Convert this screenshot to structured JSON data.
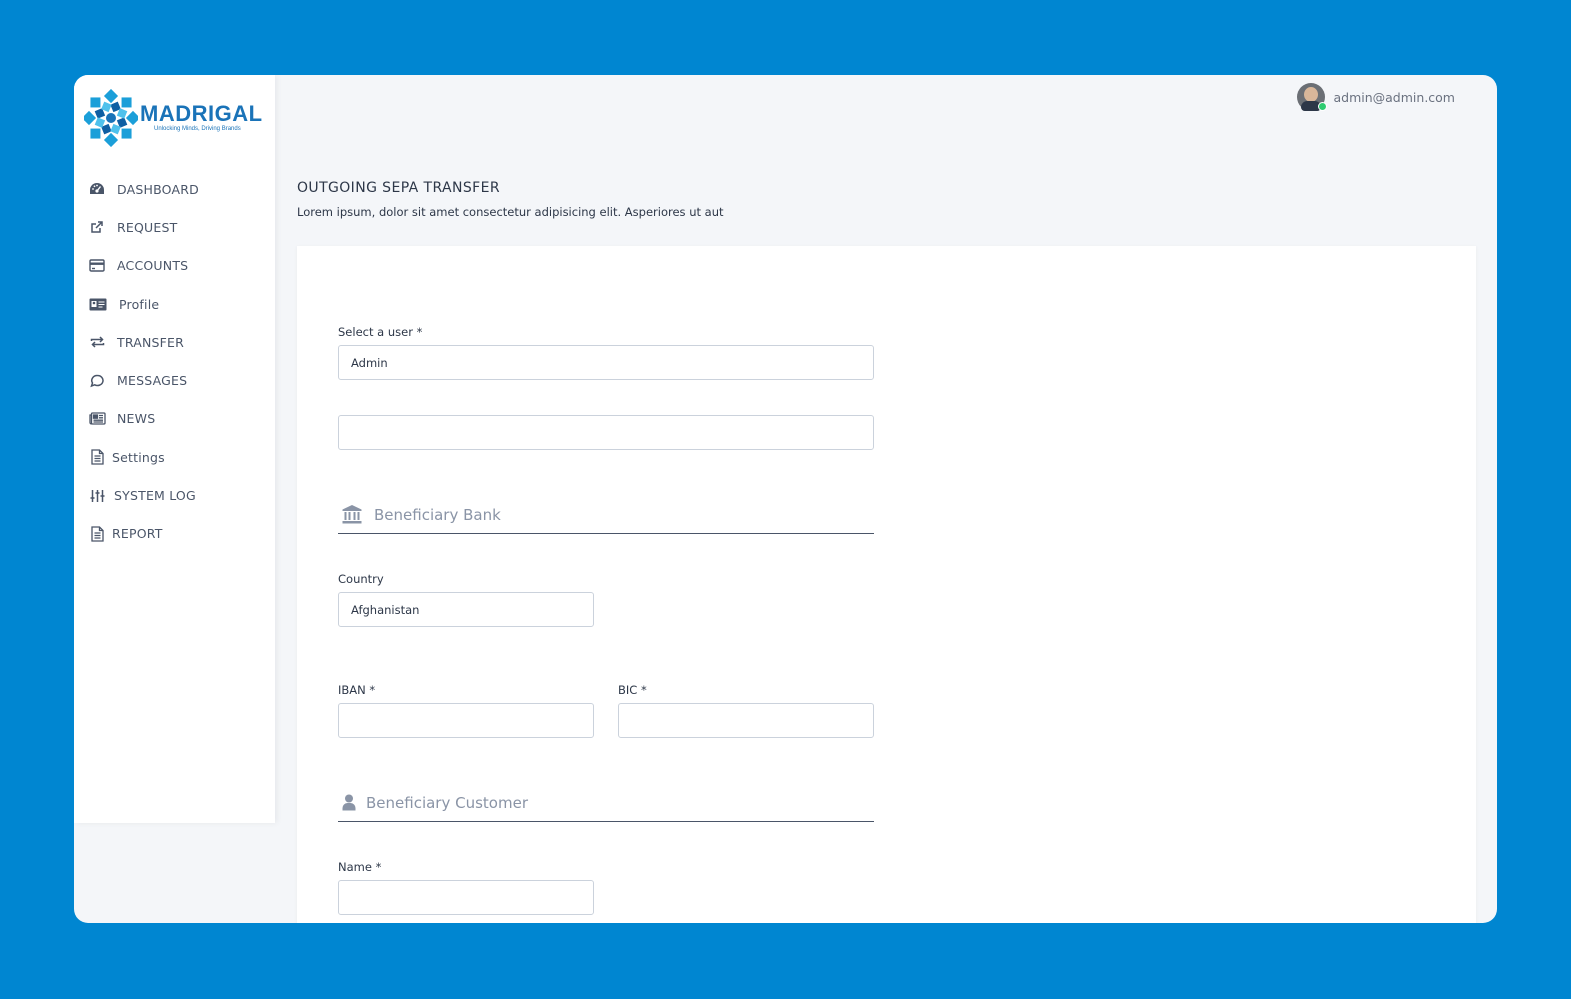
{
  "brand": {
    "name": "MADRIGAL",
    "tagline": "Unlocking Minds, Driving Brands"
  },
  "sidebar": {
    "items": [
      {
        "label": "DASHBOARD",
        "icon": "dashboard-gauge-icon"
      },
      {
        "label": "REQUEST",
        "icon": "external-link-icon"
      },
      {
        "label": "ACCOUNTS",
        "icon": "credit-card-icon"
      },
      {
        "label": "Profile",
        "icon": "id-card-icon"
      },
      {
        "label": "TRANSFER",
        "icon": "transfer-arrows-icon"
      },
      {
        "label": "MESSAGES",
        "icon": "chat-bubble-icon"
      },
      {
        "label": "NEWS",
        "icon": "newspaper-icon"
      },
      {
        "label": "Settings",
        "icon": "document-icon"
      },
      {
        "label": "SYSTEM LOG",
        "icon": "sliders-icon"
      },
      {
        "label": "REPORT",
        "icon": "document-icon"
      }
    ]
  },
  "topbar": {
    "user_email": "admin@admin.com",
    "online_status_color": "#2ecc71"
  },
  "page": {
    "title": "OUTGOING SEPA TRANSFER",
    "subtitle": "Lorem ipsum, dolor sit amet consectetur adipisicing elit. Asperiores ut aut"
  },
  "form": {
    "select_user_label": "Select a user *",
    "select_user_value": "Admin",
    "second_field_value": "",
    "beneficiary_bank_title": "Beneficiary Bank",
    "country_label": "Country",
    "country_value": "Afghanistan",
    "iban_label": "IBAN *",
    "iban_value": "",
    "bic_label": "BIC *",
    "bic_value": "",
    "beneficiary_customer_title": "Beneficiary Customer",
    "name_label": "Name *",
    "name_value": ""
  },
  "colors": {
    "background": "#0086d1",
    "brand": "#1a73b8",
    "section_title": "#8a94a6"
  }
}
